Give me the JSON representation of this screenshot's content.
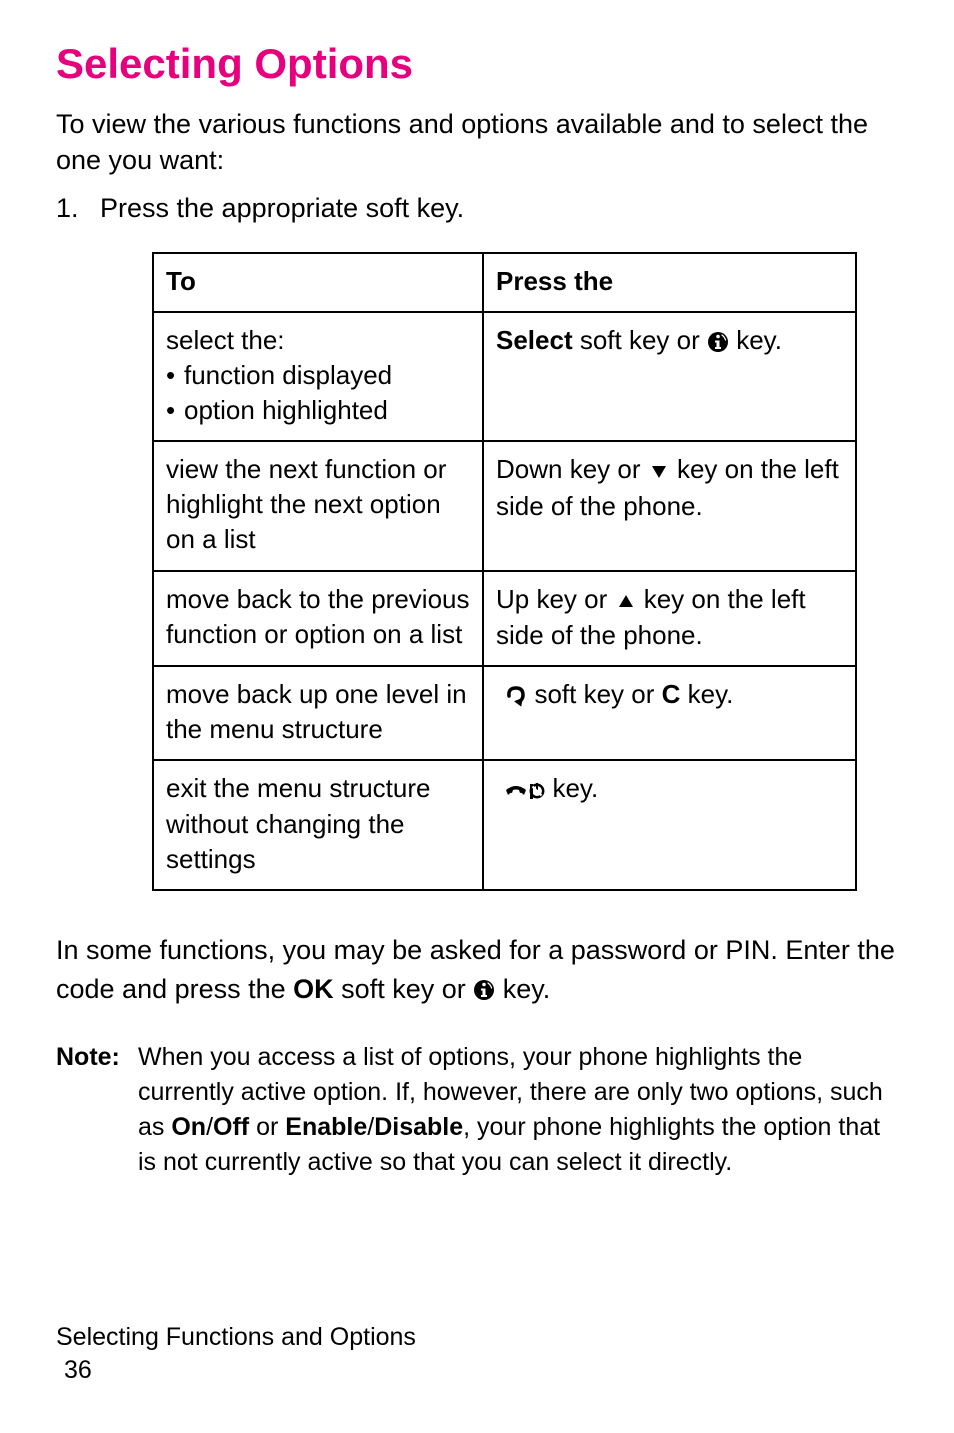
{
  "title": "Selecting Options",
  "intro": "To view the various functions and options available and to select the one you want:",
  "step_num": "1.",
  "step_text": "Press the appropriate soft key.",
  "table": {
    "headers": {
      "to": "To",
      "press": "Press the"
    },
    "rows": [
      {
        "left_lead": "select the:",
        "left_bullets": [
          "function displayed",
          "option highlighted"
        ],
        "right": {
          "pre_bold": "Select",
          "pre_tail": " soft key or ",
          "icon": "i-circle",
          "post": " key."
        }
      },
      {
        "left_plain": "view the next function or highlight the next option on a list",
        "right": {
          "pre": "Down key or ",
          "icon": "down-arrow",
          "post": " key on the left side of the phone."
        }
      },
      {
        "left_plain": "move back to the previous function or option on a list",
        "right": {
          "pre": "Up key or ",
          "icon": "up-arrow",
          "post": " key on the left side of the phone."
        }
      },
      {
        "left_plain": "move back up one level in the menu structure",
        "right": {
          "icon_lead": "back-arrow",
          "mid": " soft key or ",
          "bold": "C",
          "tail": " key."
        }
      },
      {
        "left_plain": "exit the menu structure without changing the settings",
        "right": {
          "icon_lead": "end-call",
          "tail": " key."
        }
      }
    ]
  },
  "after1": "In some functions, you may be asked for a password or PIN. Enter the code and press the ",
  "after1_bold": "OK",
  "after1_mid": " soft key or ",
  "after1_tail": " key.",
  "note_label": "Note:",
  "note": {
    "pre": "When you access a list of options, your phone highlights the currently active option. If, however, there are only two options, such as ",
    "b1": "On",
    "slash1": "/",
    "b2": "Off",
    "mid": " or ",
    "b3": "Enable",
    "slash2": "/",
    "b4": "Disable",
    "post": ", your phone highlights the option that is not currently active so that you can select it directly."
  },
  "footer_section": "Selecting Functions and Options",
  "footer_page": "36",
  "bullet_char": "•"
}
